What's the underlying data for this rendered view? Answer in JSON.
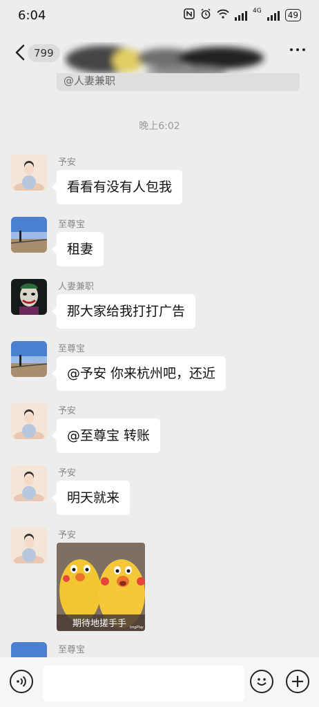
{
  "status_bar": {
    "time": "6:04",
    "network_label": "4G",
    "battery": "49"
  },
  "nav": {
    "unread_count": "799",
    "icons": [
      "back-arrow-icon",
      "more-icon"
    ]
  },
  "pinned_bar": {
    "text": "@人妻兼职"
  },
  "timestamp": "晚上6:02",
  "messages": [
    {
      "sender": "予安",
      "text": "看看有没有人包我",
      "avatar": "girl-avatar"
    },
    {
      "sender": "至尊宝",
      "text": "租妻",
      "avatar": "landscape-avatar"
    },
    {
      "sender": "人妻兼职",
      "text": "那大家给我打打广告",
      "avatar": "joker-avatar"
    },
    {
      "sender": "至尊宝",
      "text": "@予安  你来杭州吧，还近",
      "avatar": "landscape-avatar"
    },
    {
      "sender": "予安",
      "text": "@至尊宝  转账",
      "avatar": "girl-avatar"
    },
    {
      "sender": "予安",
      "text": "明天就来",
      "avatar": "girl-avatar"
    },
    {
      "sender": "予安",
      "sticker_caption": "期待地搓手手",
      "sticker_watermark": "ImgPlay",
      "avatar": "girl-avatar"
    },
    {
      "sender": "至尊宝",
      "avatar": "landscape-avatar"
    }
  ],
  "input_bar": {
    "icons": [
      "voice-icon",
      "emoji-icon",
      "plus-icon"
    ]
  }
}
